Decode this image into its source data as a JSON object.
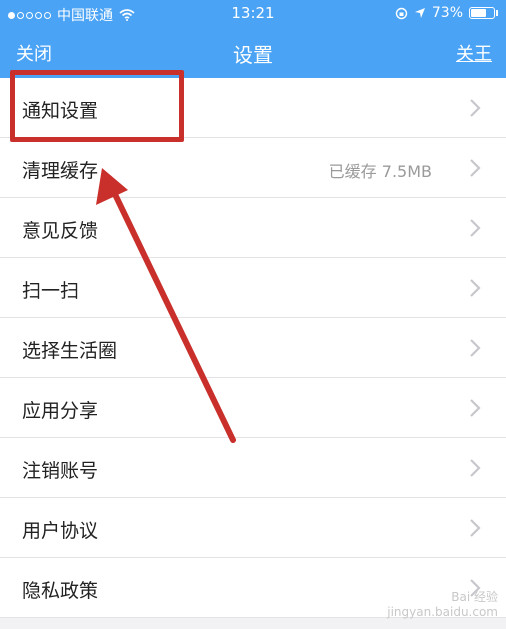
{
  "status_bar": {
    "carrier": "中国联通",
    "time": "13:21",
    "battery_percent": "73%",
    "battery_level": 0.73
  },
  "nav": {
    "left_label": "关闭",
    "title": "设置",
    "right_label": "关王"
  },
  "rows": [
    {
      "label": "通知设置",
      "value": ""
    },
    {
      "label": "清理缓存",
      "value": "已缓存 7.5MB"
    },
    {
      "label": "意见反馈",
      "value": ""
    },
    {
      "label": "扫一扫",
      "value": ""
    },
    {
      "label": "选择生活圈",
      "value": ""
    },
    {
      "label": "应用分享",
      "value": ""
    },
    {
      "label": "注销账号",
      "value": ""
    },
    {
      "label": "用户协议",
      "value": ""
    },
    {
      "label": "隐私政策",
      "value": ""
    }
  ],
  "watermark": {
    "line1": "Bai 经验",
    "line2": "jingyan.baidu.com"
  },
  "colors": {
    "header": "#4aa3f5",
    "annotation": "#c9302c"
  }
}
